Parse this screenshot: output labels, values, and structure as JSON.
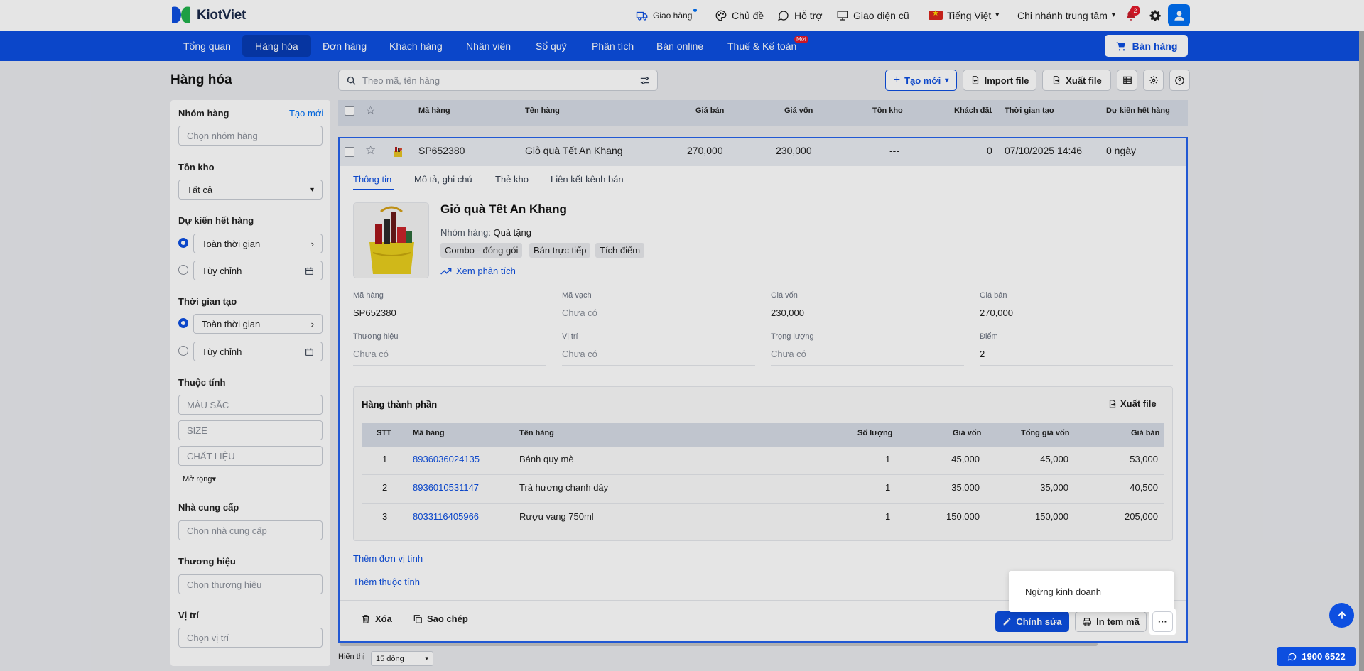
{
  "brand": {
    "name": "KiotViet"
  },
  "topbar": {
    "delivery": "Giao hàng",
    "theme": "Chủ đề",
    "support": "Hỗ trợ",
    "old_ui": "Giao diện cũ",
    "language": "Tiếng Việt",
    "branch": "Chi nhánh trung tâm",
    "notifications_count": "2"
  },
  "nav": {
    "items": [
      "Tổng quan",
      "Hàng hóa",
      "Đơn hàng",
      "Khách hàng",
      "Nhân viên",
      "Sổ quỹ",
      "Phân tích",
      "Bán online",
      "Thuế & Kế toán"
    ],
    "active_index": 1,
    "new_badge": "Mới",
    "sell_button": "Bán hàng"
  },
  "page": {
    "title": "Hàng hóa"
  },
  "filters": {
    "group": {
      "label": "Nhóm hàng",
      "create_link": "Tạo mới",
      "placeholder": "Chọn nhóm hàng"
    },
    "stock": {
      "label": "Tồn kho",
      "value": "Tất cả"
    },
    "expected_out": {
      "label": "Dự kiến hết hàng",
      "option_all": "Toàn thời gian",
      "option_custom": "Tùy chỉnh"
    },
    "created_time": {
      "label": "Thời gian tạo",
      "option_all": "Toàn thời gian",
      "option_custom": "Tùy chỉnh"
    },
    "attributes": {
      "label": "Thuộc tính",
      "color": "MÀU SẮC",
      "size": "SIZE",
      "material": "CHẤT LIỆU",
      "expand": "Mở rộng"
    },
    "supplier": {
      "label": "Nhà cung cấp",
      "placeholder": "Chọn nhà cung cấp"
    },
    "brand": {
      "label": "Thương hiệu",
      "placeholder": "Chọn thương hiệu"
    },
    "location": {
      "label": "Vị trí",
      "placeholder": "Chọn vị trí"
    }
  },
  "toolbar": {
    "search_placeholder": "Theo mã, tên hàng",
    "create_new": "Tạo mới",
    "import_file": "Import file",
    "export_file": "Xuất file"
  },
  "table": {
    "columns": [
      "Mã hàng",
      "Tên hàng",
      "Giá bán",
      "Giá vốn",
      "Tồn kho",
      "Khách đặt",
      "Thời gian tạo",
      "Dự kiến hết hàng"
    ],
    "row": {
      "code": "SP652380",
      "name": "Giỏ quà Tết An Khang",
      "price": "270,000",
      "cost": "230,000",
      "stock": "---",
      "ordered": "0",
      "created": "07/10/2025 14:46",
      "expected": "0 ngày"
    }
  },
  "detail": {
    "tabs": [
      "Thông tin",
      "Mô tả, ghi chú",
      "Thẻ kho",
      "Liên kết kênh bán"
    ],
    "name": "Giỏ quà Tết An Khang",
    "group_label": "Nhóm hàng:",
    "group_value": "Quà tặng",
    "tags": [
      "Combo - đóng gói",
      "Bán trực tiếp",
      "Tích điểm"
    ],
    "analysis_link": "Xem phân tích",
    "fields": [
      {
        "label": "Mã hàng",
        "value": "SP652380",
        "muted": false
      },
      {
        "label": "Mã vạch",
        "value": "Chưa có",
        "muted": true
      },
      {
        "label": "Giá vốn",
        "value": "230,000",
        "muted": false
      },
      {
        "label": "Giá bán",
        "value": "270,000",
        "muted": false
      },
      {
        "label": "Thương hiệu",
        "value": "Chưa có",
        "muted": true
      },
      {
        "label": "Vị trí",
        "value": "Chưa có",
        "muted": true
      },
      {
        "label": "Trọng lượng",
        "value": "Chưa có",
        "muted": true
      },
      {
        "label": "Điểm",
        "value": "2",
        "muted": false
      }
    ],
    "components": {
      "title": "Hàng thành phần",
      "export": "Xuất file",
      "columns": [
        "STT",
        "Mã hàng",
        "Tên hàng",
        "Số lượng",
        "Giá vốn",
        "Tổng giá vốn",
        "Giá bán"
      ],
      "rows": [
        [
          "1",
          "8936036024135",
          "Bánh quy mè",
          "1",
          "45,000",
          "45,000",
          "53,000"
        ],
        [
          "2",
          "8936010531147",
          "Trà hương chanh dây",
          "1",
          "35,000",
          "35,000",
          "40,500"
        ],
        [
          "3",
          "8033116405966",
          "Rượu vang 750ml",
          "1",
          "150,000",
          "150,000",
          "205,000"
        ]
      ]
    },
    "add_unit": "Thêm đơn vị tính",
    "add_attribute": "Thêm thuộc tính",
    "delete": "Xóa",
    "copy": "Sao chép",
    "edit": "Chỉnh sửa",
    "print_label": "In tem mã",
    "more": "···"
  },
  "popup": {
    "stop_selling": "Ngừng kinh doanh"
  },
  "footer": {
    "display_label": "Hiển thị",
    "page_size": "15 dòng"
  },
  "hotline": "1900 6522"
}
